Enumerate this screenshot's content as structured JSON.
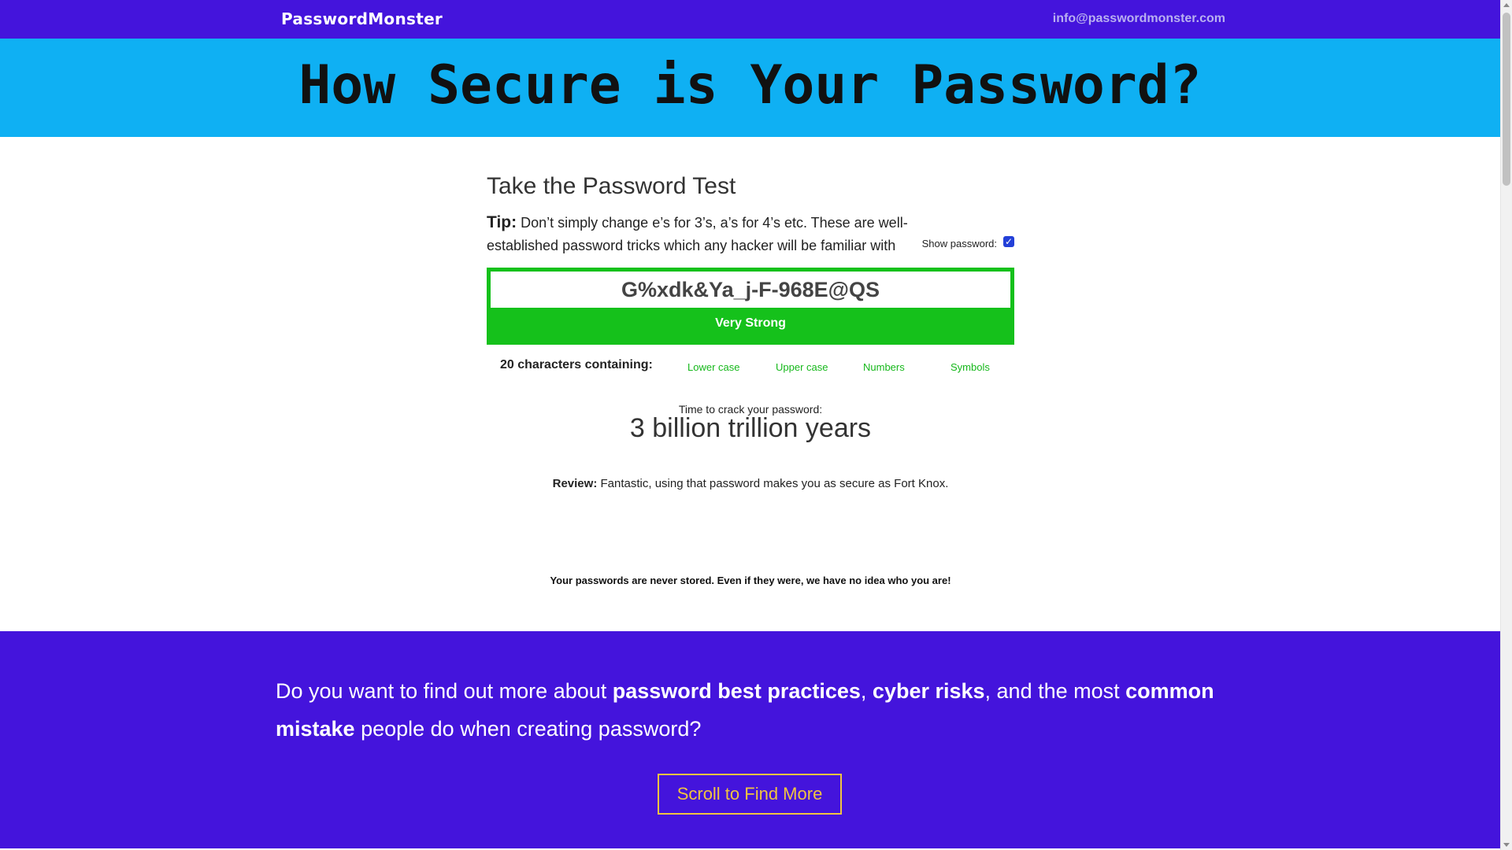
{
  "topbar": {
    "logo": "PasswordMonster",
    "email": "info@passwordmonster.com"
  },
  "hero": {
    "title": "How Secure is Your Password?"
  },
  "test": {
    "heading": "Take the Password Test",
    "tip_label": "Tip:",
    "tip_text": " Don’t simply change e’s for 3’s, a’s for 4’s etc. These are well-established password tricks which any hacker will be familiar with",
    "show_password_label": "Show password:",
    "show_password_checked": true,
    "password_value": "G%xdk&Ya_j-F-968E@QS",
    "strength": "Very Strong",
    "strength_color": "#15c11b",
    "char_count_text": "20 characters containing:",
    "char_types": [
      "Lower case",
      "Upper case",
      "Numbers",
      "Symbols"
    ],
    "crack_label": "Time to crack your password:",
    "crack_value": "3 billion trillion years",
    "review_label": "Review:",
    "review_text": " Fantastic, using that password makes you as secure as Fort Knox.",
    "privacy_note": "Your passwords are never stored. Even if they were, we have no idea who you are!"
  },
  "info": {
    "text_1": "Do you want to find out more about ",
    "bold_1": "password best practices",
    "text_2": ", ",
    "bold_2": "cyber risks",
    "text_3": ", and the most ",
    "bold_3": "common mistake",
    "text_4": " people do when creating password?",
    "button": "Scroll to Find More"
  },
  "colors": {
    "brand_purple": "#4414dc",
    "hero_blue": "#0fb0f3",
    "success_green": "#15c11b",
    "button_gold": "#f0c440"
  }
}
